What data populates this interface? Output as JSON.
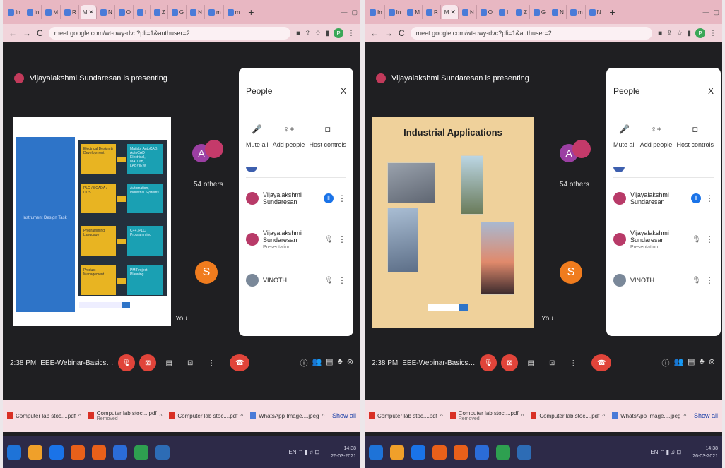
{
  "url": "meet.google.com/wt-owy-dvc?pli=1&authuser=2",
  "tabs": [
    "In",
    "In",
    "M",
    "R",
    "M",
    "N",
    "O",
    "I",
    "Z",
    "G",
    "N",
    "m",
    "m",
    "N"
  ],
  "presenting_banner": "Vijayalakshmi Sundaresan is presenting",
  "participants_tiles": {
    "a_initial": "A",
    "others_label": "54 others",
    "you_initial": "S",
    "you_label": "You"
  },
  "people_panel": {
    "title": "People",
    "close": "X",
    "actions": [
      {
        "label": "Mute all",
        "icon": "mic-slash-icon"
      },
      {
        "label": "Add people",
        "icon": "person-add-icon"
      },
      {
        "label": "Host controls",
        "icon": "host-controls-icon"
      }
    ],
    "list": [
      {
        "name": "Vijayalakshmi Sundaresan",
        "sub": "",
        "state": "speaking"
      },
      {
        "name": "Vijayalakshmi Sundaresan",
        "sub": "Presentation",
        "state": "muted"
      },
      {
        "name": "VINOTH",
        "sub": "",
        "state": "muted"
      }
    ]
  },
  "bottom_bar": {
    "left_time": "2:38 PM",
    "right_time": "2:38 PM",
    "meeting_name": "EEE-Webinar-Basics of Instrum..."
  },
  "slide_left": {
    "side_label": "Instrument Design Task",
    "yellow_boxes": [
      "Electrical Design & Development",
      "PLC / SCADA / DCS",
      "Programming Language",
      "Product Management"
    ],
    "teal_boxes": [
      "Matlab, AutoCAD, AutoCAD Electrical, MATLab, LABVIEW",
      "Automation, Industrial Systems",
      "C++, PLC Programming",
      "PM Project Planning"
    ]
  },
  "slide_right": {
    "title": "Industrial Applications"
  },
  "downloads": {
    "items_left": [
      {
        "name": "Computer lab stoc....pdf",
        "sub": ""
      },
      {
        "name": "Computer lab stoc....pdf",
        "sub": "Removed"
      },
      {
        "name": "Computer lab stoc....pdf",
        "sub": ""
      },
      {
        "name": "WhatsApp Image....jpeg",
        "sub": ""
      }
    ],
    "items_right": [
      {
        "name": "Computer lab stoc....pdf",
        "sub": ""
      },
      {
        "name": "Computer lab stoc....pdf",
        "sub": "Removed"
      },
      {
        "name": "Computer lab stoc....pdf",
        "sub": ""
      },
      {
        "name": "WhatsApp Image....jpeg",
        "sub": ""
      }
    ],
    "show_all": "Show all"
  },
  "taskbar": {
    "clock_left": "14:38",
    "date_left": "26-03-2021",
    "clock_right": "14:38",
    "date_right": "26-03-2021",
    "app_colors": [
      "#1e73d8",
      "#f0a02a",
      "#1a73e8",
      "#e8601a",
      "#e8601a",
      "#2b6cd8",
      "#2ea050",
      "#2d6cb5"
    ]
  }
}
